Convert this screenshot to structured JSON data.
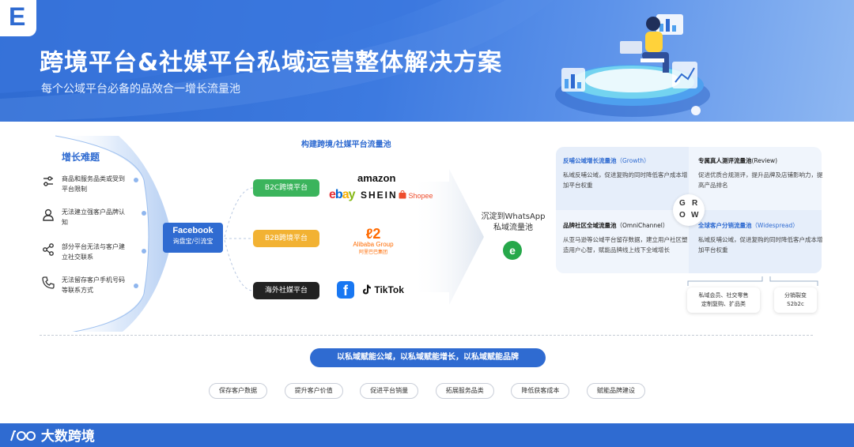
{
  "header": {
    "logo_letter": "E",
    "title": "跨境平台&社媒平台私域运营整体解决方案",
    "subtitle": "每个公域平台必备的品效合一增长流量池"
  },
  "problems": {
    "title": "增长难题",
    "items": [
      {
        "icon": "sliders-icon",
        "text": "商品和服务品类或受到平台限制"
      },
      {
        "icon": "user-icon",
        "text": "无法建立强客户品牌认知"
      },
      {
        "icon": "share-icon",
        "text": "部分平台无法与客户建立社交联系"
      },
      {
        "icon": "phone-icon",
        "text": "无法留存客户手机号码等联系方式"
      }
    ]
  },
  "facebook": {
    "line1": "Facebook",
    "line2": "询盘宝/引流宝"
  },
  "pool": {
    "title": "构建跨境/社媒平台流量池",
    "platforms": [
      {
        "label": "B2C跨境平台",
        "color": "#3bb45c"
      },
      {
        "label": "B2B跨境平台",
        "color": "#f2b233"
      },
      {
        "label": "海外社媒平台",
        "color": "#222222"
      }
    ],
    "brands": {
      "amazon": "amazon",
      "ebay": "ebay",
      "shein": "SHEIN",
      "shopee": "Shopee",
      "alibaba": "Alibaba Group",
      "alibaba_cn": "阿里巴巴集团",
      "facebook": "f",
      "tiktok": "TikTok"
    }
  },
  "whatsapp": {
    "line1": "沉淀到WhatsApp",
    "line2": "私域流量池",
    "icon": "e"
  },
  "grow": {
    "letters": [
      "G",
      "R",
      "O",
      "W"
    ],
    "quadrants": [
      {
        "title": "反哺公域增长流量池",
        "en": "（Growth）",
        "body": "私域反哺公域，促进复购的同时降低客户成本增加平台权重"
      },
      {
        "title": "专属真人测评流量池",
        "en": "(Review)",
        "body": "促进优质合规测评，提升品牌及店铺影响力，提高产品排名"
      },
      {
        "title": "品牌社区全域流量池",
        "en": "（OmniChannel）",
        "body": "从亚马逊等公域平台留存数据，建立用户社区塑造用户心智，赋能品牌线上线下全域增长"
      },
      {
        "title": "全球客户分销流量池",
        "en": "（Widespread）",
        "body": "私域反哺公域，促进复购的同时降低客户成本增加平台权重"
      }
    ],
    "sub_boxes": [
      {
        "line1": "私域会员、社交零售",
        "line2": "定制复购、扩品类"
      },
      {
        "line1": "分销裂变",
        "line2": "S2b2c"
      }
    ]
  },
  "slogan": "以私域赋能公域，以私域赋能增长，以私域赋能品牌",
  "tags": [
    "保存客户数据",
    "提升客户价值",
    "促进平台销量",
    "拓展服务品类",
    "降低获客成本",
    "赋能品牌建设"
  ],
  "footer": {
    "logo_text": "大数跨境"
  },
  "colors": {
    "primary": "#2f6bd1",
    "green": "#3bb45c",
    "yellow": "#f2b233",
    "black": "#222222"
  }
}
